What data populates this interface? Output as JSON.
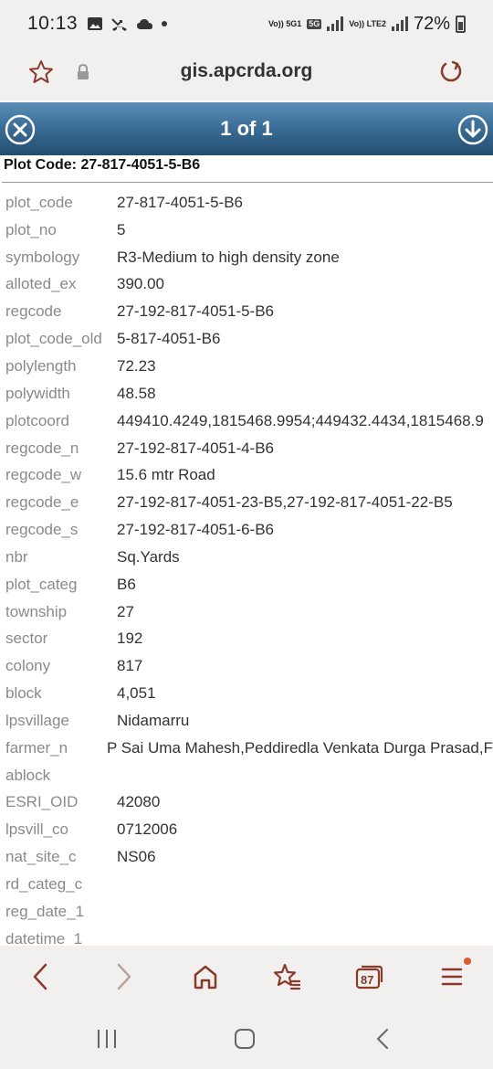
{
  "status_bar": {
    "time": "10:13",
    "network_labels": [
      "Vo)) 5G1",
      "5G",
      "Vo)) LTE2"
    ],
    "battery": "72%"
  },
  "browser": {
    "url": "gis.apcrda.org",
    "tab_count": "87",
    "icons": [
      "star-icon",
      "lock-icon",
      "reload-icon",
      "back-icon",
      "forward-icon",
      "home-icon",
      "favorites-icon",
      "tabs-icon",
      "menu-icon"
    ]
  },
  "popup": {
    "title": "1 of 1",
    "heading": "Plot Code: 27-817-4051-5-B6",
    "attributes": [
      {
        "key": "plot_code",
        "value": "27-817-4051-5-B6"
      },
      {
        "key": "plot_no",
        "value": "5"
      },
      {
        "key": "symbology",
        "value": "R3-Medium to high density zone"
      },
      {
        "key": "alloted_ex",
        "value": "390.00"
      },
      {
        "key": "regcode",
        "value": "27-192-817-4051-5-B6"
      },
      {
        "key": "plot_code_old",
        "value": "5-817-4051-B6"
      },
      {
        "key": "polylength",
        "value": "72.23"
      },
      {
        "key": "polywidth",
        "value": "48.58"
      },
      {
        "key": "plotcoord",
        "value": "449410.4249,1815468.9954;449432.4434,1815468.9"
      },
      {
        "key": "regcode_n",
        "value": "27-192-817-4051-4-B6"
      },
      {
        "key": "regcode_w",
        "value": "15.6 mtr Road"
      },
      {
        "key": "regcode_e",
        "value": "27-192-817-4051-23-B5,27-192-817-4051-22-B5"
      },
      {
        "key": "regcode_s",
        "value": "27-192-817-4051-6-B6"
      },
      {
        "key": "nbr",
        "value": "Sq.Yards"
      },
      {
        "key": "plot_categ",
        "value": "B6"
      },
      {
        "key": "township",
        "value": "27"
      },
      {
        "key": "sector",
        "value": "192"
      },
      {
        "key": "colony",
        "value": "817"
      },
      {
        "key": "block",
        "value": "4,051"
      },
      {
        "key": "lpsvillage",
        "value": "Nidamarru"
      },
      {
        "key": "farmer_n",
        "value": "P Sai Uma Mahesh,Peddiredla Venkata Durga Prasad,F"
      },
      {
        "key": "ablock",
        "value": ""
      },
      {
        "key": "ESRI_OID",
        "value": "42080"
      },
      {
        "key": "lpsvill_co",
        "value": "0712006"
      },
      {
        "key": "nat_site_c",
        "value": "NS06"
      },
      {
        "key": "rd_categ_c",
        "value": ""
      },
      {
        "key": "reg_date_1",
        "value": ""
      },
      {
        "key": "datetime_1",
        "value": ""
      }
    ]
  },
  "colors": {
    "header_gradient_top": "#5b8fb8",
    "header_gradient_bottom": "#234d6e",
    "browser_icon": "#8a3a2a",
    "notification_dot": "#e1592c"
  }
}
